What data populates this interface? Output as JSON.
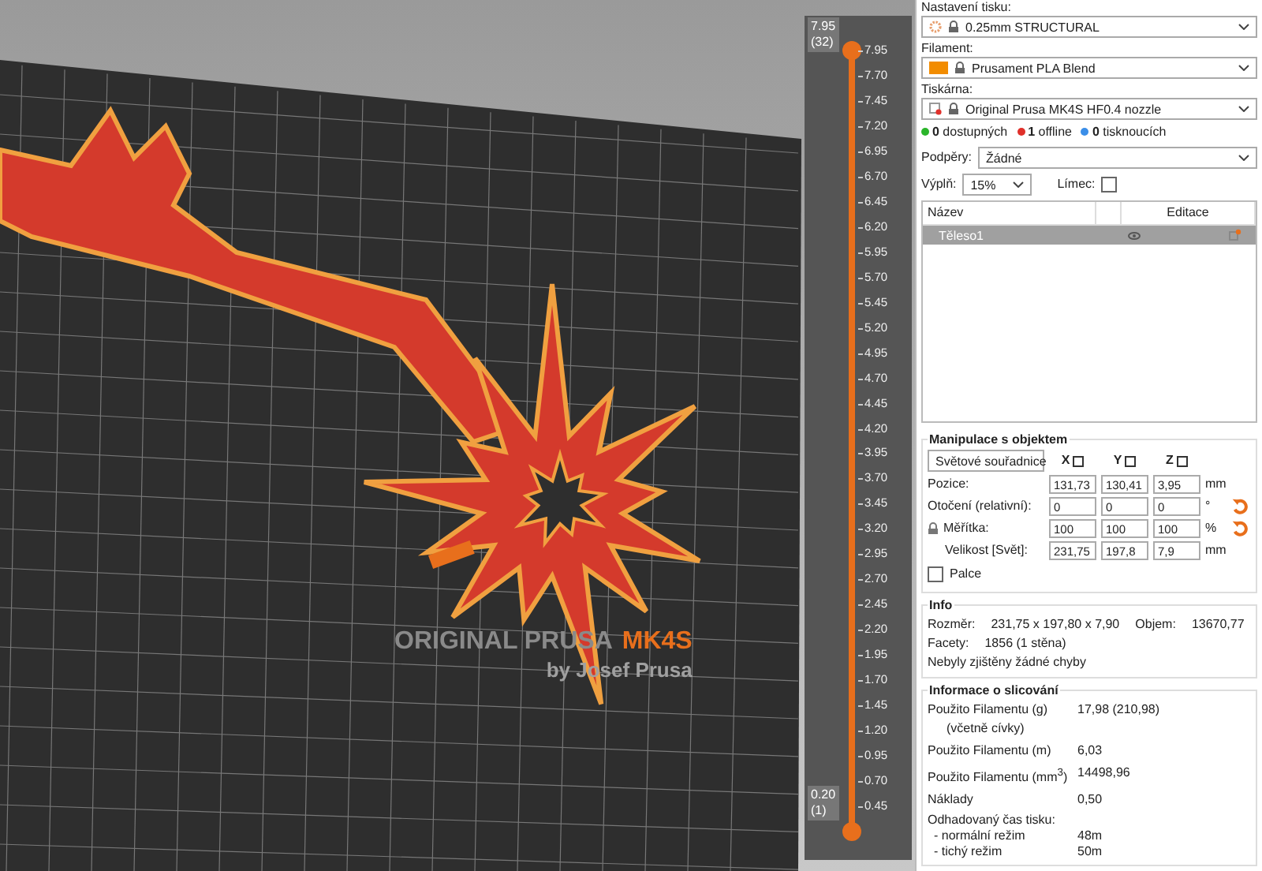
{
  "print_settings": {
    "label": "Nastavení tisku:",
    "value": "0.25mm STRUCTURAL"
  },
  "filament": {
    "label": "Filament:",
    "value": "Prusament PLA Blend",
    "color": "#f28c00"
  },
  "printer": {
    "label": "Tiskárna:",
    "value": "Original Prusa MK4S HF0.4 nozzle"
  },
  "printer_status": [
    {
      "text": "**0** dostupných",
      "color": "#2bb52b"
    },
    {
      "text": "**1** offline",
      "color": "#e0302a"
    },
    {
      "text": "**0** tisknoucích",
      "color": "#3b8ee8"
    }
  ],
  "supports": {
    "label": "Podpěry:",
    "value": "Žádné"
  },
  "infill": {
    "label": "Výplň:",
    "value": "15%"
  },
  "brim": {
    "label": "Límec:",
    "checked": false
  },
  "object_list": {
    "columns": [
      "Název",
      "Editace"
    ],
    "rows": [
      {
        "name": "Těleso1",
        "selected": true
      }
    ]
  },
  "manipulation": {
    "title": "Manipulace s objektem",
    "coord_system": "Světové souřadnice",
    "axes": [
      "X",
      "Y",
      "Z"
    ],
    "rows": [
      {
        "label": "Pozice:",
        "values": [
          "131,73",
          "130,41",
          "3,95"
        ],
        "unit": "mm",
        "reset": false
      },
      {
        "label": "Otočení (relativní):",
        "values": [
          "0",
          "0",
          "0"
        ],
        "unit": "°",
        "reset": true
      },
      {
        "label": "Měřítka:",
        "values": [
          "100",
          "100",
          "100"
        ],
        "unit": "%",
        "reset": true
      },
      {
        "label": "Velikost [Svět]:",
        "values": [
          "231,75",
          "197,8",
          "7,9"
        ],
        "unit": "mm",
        "reset": false
      }
    ],
    "inches": {
      "label": "Palce",
      "checked": false
    }
  },
  "info": {
    "title": "Info",
    "size_label": "Rozměr:",
    "size": "231,75 x 197,80 x 7,90",
    "volume_label": "Objem:",
    "volume": "13670,77",
    "facets_label": "Facety:",
    "facets": "1856 (1 stěna)",
    "status": "Nebyly zjištěny žádné chyby"
  },
  "slicing_info": {
    "title": "Informace o slicování",
    "rows": [
      {
        "label": "Použito Filamentu (g)",
        "sublabel": "(včetně cívky)",
        "value": "17,98 (210,98)"
      },
      {
        "label": "Použito Filamentu (m)",
        "value": "6,03"
      },
      {
        "label": "Použito Filamentu (mm$^{3}$)",
        "value": "14498,96"
      },
      {
        "label": "Náklady",
        "value": "0,50"
      }
    ],
    "time_label": "Odhadovaný čas tisku:",
    "times": [
      {
        "label": "- normální režim",
        "value": "48m"
      },
      {
        "label": "- tichý režim",
        "value": "50m"
      }
    ]
  },
  "layer_slider": {
    "top_value": "7.95",
    "top_layer": "(32)",
    "bottom_value": "0.20",
    "bottom_layer": "(1)",
    "upper_handle": {
      "level": 1
    },
    "lower_handle": {
      "level": 0
    },
    "ticks": [
      "7.95",
      "7.70",
      "7.45",
      "7.20",
      "6.95",
      "6.70",
      "6.45",
      "6.20",
      "5.95",
      "5.70",
      "5.45",
      "5.20",
      "4.95",
      "4.70",
      "4.45",
      "4.20",
      "3.95",
      "3.70",
      "3.45",
      "3.20",
      "2.95",
      "2.70",
      "2.45",
      "2.20",
      "1.95",
      "1.70",
      "1.45",
      "1.20",
      "0.95",
      "0.70",
      "0.45"
    ]
  },
  "bed_logo": {
    "brand": "ORIGINAL PRUSA",
    "model": "MK4S",
    "byline": "by Josef Prusa"
  }
}
